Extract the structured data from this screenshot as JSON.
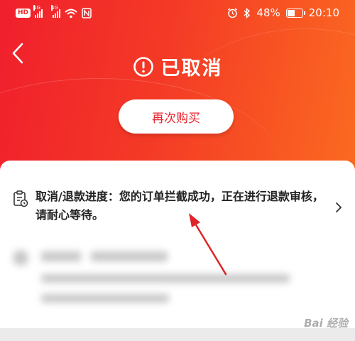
{
  "status_bar": {
    "hd_label": "HD",
    "network_left": "4G",
    "network_right": "4G",
    "battery": "48%",
    "time": "20:10"
  },
  "header": {
    "status_title": "已取消",
    "rebuy_label": "再次购买",
    "gradient_colors": [
      "#f01f2c",
      "#fb6a20"
    ]
  },
  "progress": {
    "text": "取消/退款进度：您的订单拦截成功，正在进行退款审核，请耐心等待。"
  },
  "watermark": {
    "text": "Bai 经验"
  },
  "colors": {
    "accent": "#e8232d",
    "annotation_arrow": "#e0242a"
  }
}
